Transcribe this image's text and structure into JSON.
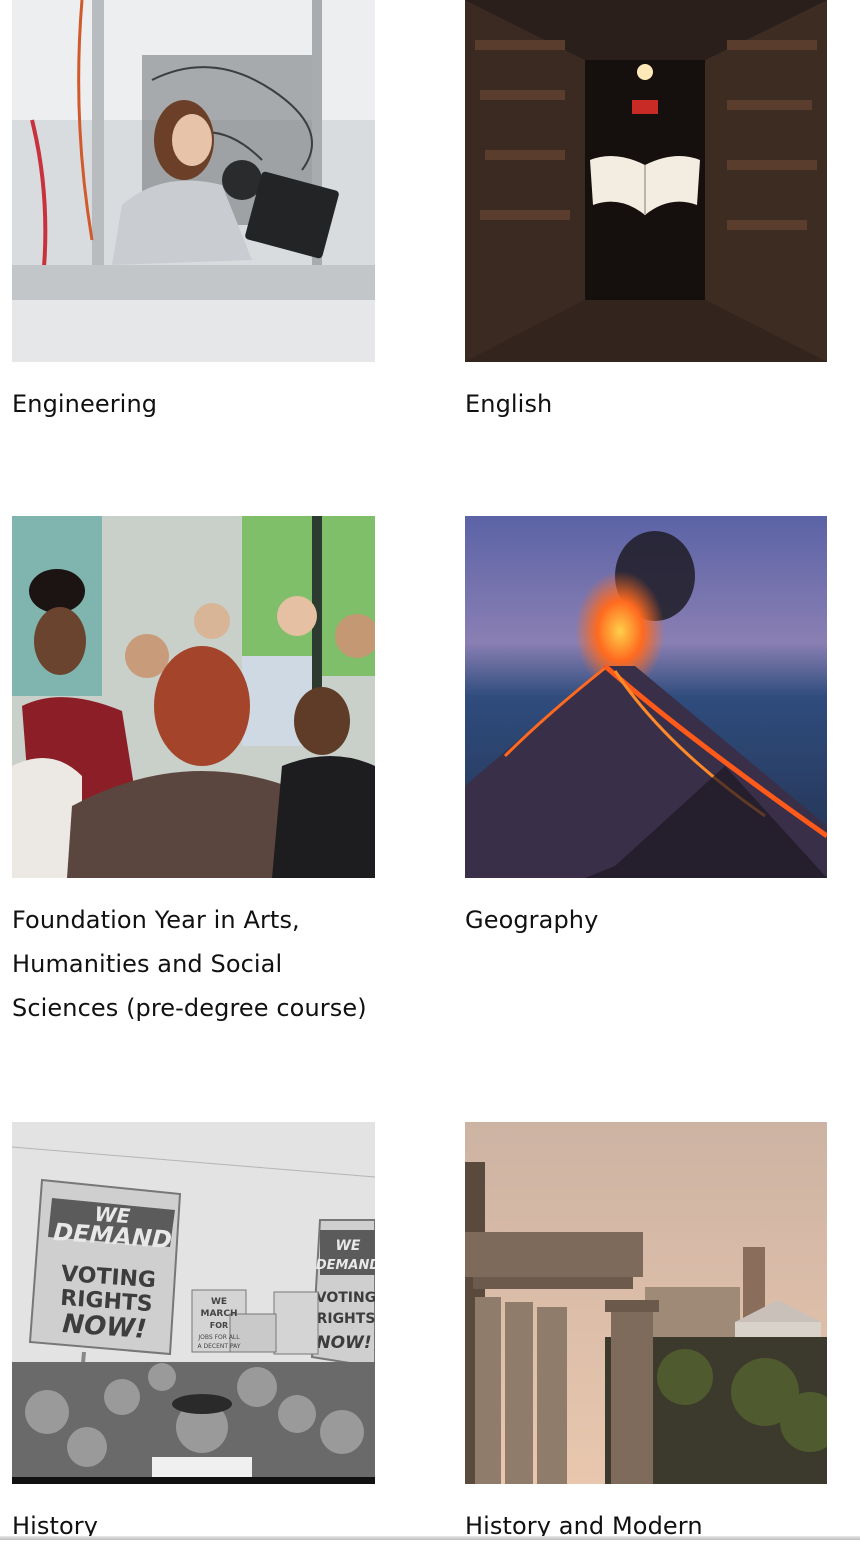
{
  "courses": [
    {
      "title": "Engineering",
      "image_icon": "engineering-lab-photo"
    },
    {
      "title": "English",
      "image_icon": "flying-book-library-photo"
    },
    {
      "title": "Foundation Year in Arts, Humanities and Social Sciences (pre-degree course)",
      "image_icon": "students-group-photo"
    },
    {
      "title": "Geography",
      "image_icon": "erupting-volcano-photo"
    },
    {
      "title": "History",
      "image_icon": "voting-rights-march-photo"
    },
    {
      "title": "History and Modern",
      "image_icon": "roman-ruins-photo"
    }
  ],
  "signs": {
    "big": [
      "WE",
      "DEMAND",
      "VOTING",
      "RIGHTS",
      "NOW!"
    ],
    "right": [
      "WE",
      "DEMAND",
      "VOTING",
      "RIGHTS",
      "NOW!"
    ],
    "small": [
      "WE",
      "MARCH",
      "FOR",
      "JOBS FOR ALL",
      "A DECENT PAY"
    ]
  },
  "colors": {
    "background": "#ffffff",
    "text": "#111111"
  }
}
